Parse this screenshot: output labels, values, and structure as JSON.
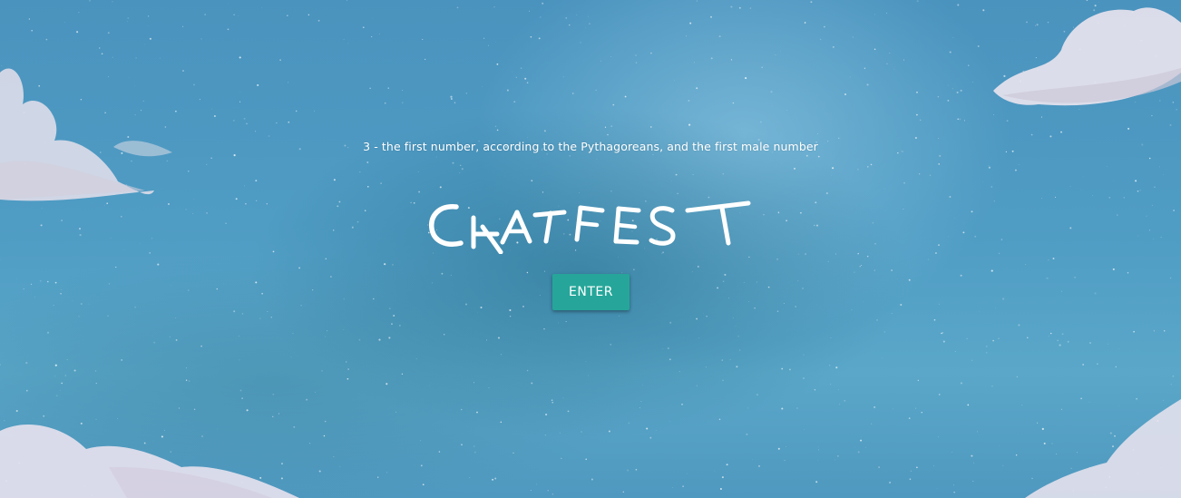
{
  "hero": {
    "tagline": "3 - the first number, according to the Pythagoreans, and the first male number",
    "logo_letters": [
      "C",
      "H",
      "A",
      "T",
      "F",
      "E",
      "S",
      "T"
    ],
    "enter_label": "ENTER"
  },
  "colors": {
    "button": "#26a69a",
    "text": "#ffffff",
    "sky": "#4f9cc4"
  }
}
